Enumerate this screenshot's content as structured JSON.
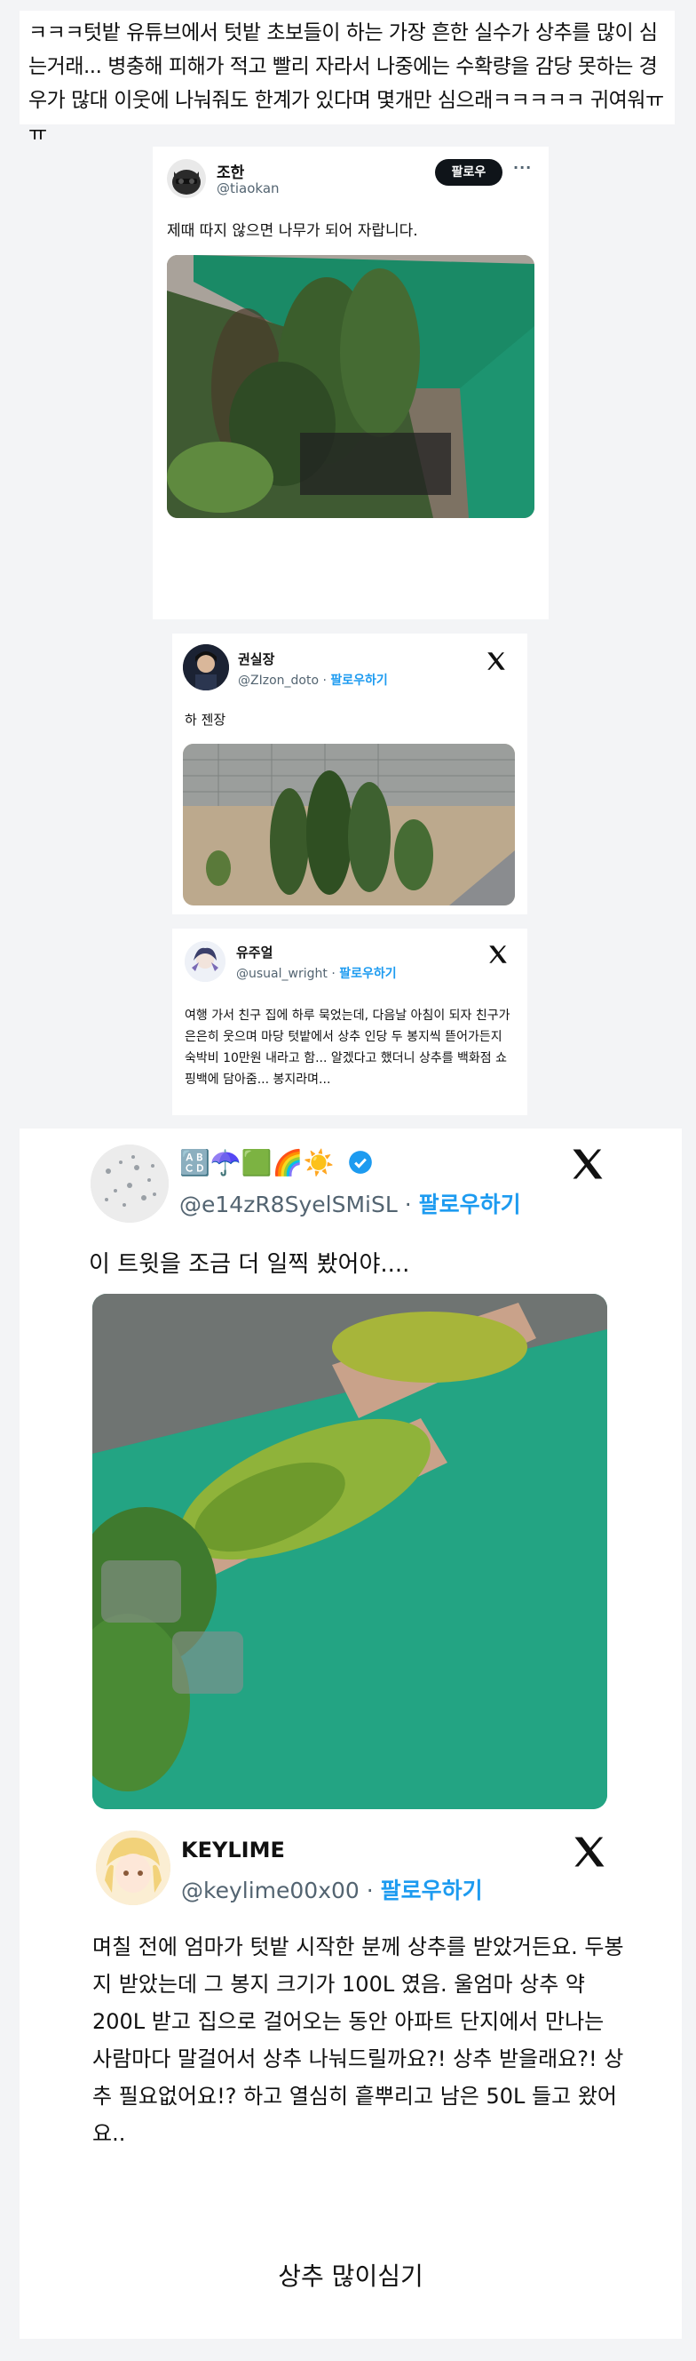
{
  "intro_text": "ㅋㅋㅋ텃밭 유튜브에서 텃밭 초보들이 하는 가장 흔한 실수가 상추를 많이 심는거래... 병충해 피해가 적고 빨리 자라서 나중에는 수확량을 감당 못하는 경우가 많대 이웃에 나눠줘도 한계가 있다며 몇개만 심으래ㅋㅋㅋㅋㅋ 귀여워ㅠㅠ",
  "tweet1": {
    "name": "조한",
    "handle": "@tiaokan",
    "follow_label": "팔로우",
    "more_label": "···",
    "text": "제때 따지 않으면 나무가 되어 자랍니다."
  },
  "tweet2": {
    "name": "권실장",
    "handle": "@ZIzon_doto",
    "separator": "·",
    "follow_label": "팔로우하기",
    "text": "하 젠장"
  },
  "tweet3": {
    "name": "유주얼",
    "handle": "@usual_wright",
    "separator": "·",
    "follow_label": "팔로우하기",
    "text": "여행 가서 친구 집에 하루 묵었는데, 다음날 아침이 되자 친구가 은은히 웃으며 마당 텃밭에서 상추 인당 두 봉지씩 뜯어가든지 숙박비 10만원 내라고 함... 알겠다고 했더니 상추를 백화점 쇼핑백에 담아줌... 봉지라며..."
  },
  "tweet4": {
    "emoji_name": "🔠☂️🟩🌈☀️",
    "handle": "@e14zR8SyelSMiSL",
    "separator": "·",
    "follow_label": "팔로우하기",
    "text": "이 트윗을 조금 더 일찍 봤어야...."
  },
  "tweet5": {
    "name": "KEYLIME",
    "handle": "@keylime00x00",
    "separator": "·",
    "follow_label": "팔로우하기",
    "text": "며칠 전에 엄마가 텃밭 시작한 분께 상추를 받았거든요. 두봉지 받았는데 그 봉지 크기가 100L 였음. 울엄마 상추 약 200L 받고 집으로 걸어오는 동안 아파트 단지에서 만나는 사람마다 말걸어서 상추 나눠드릴까요?! 상추 받을래요?! 상추 필요없어요!? 하고 열심히 흩뿌리고 남은 50L 들고 왔어요.."
  },
  "footer_title": "상추 많이심기"
}
